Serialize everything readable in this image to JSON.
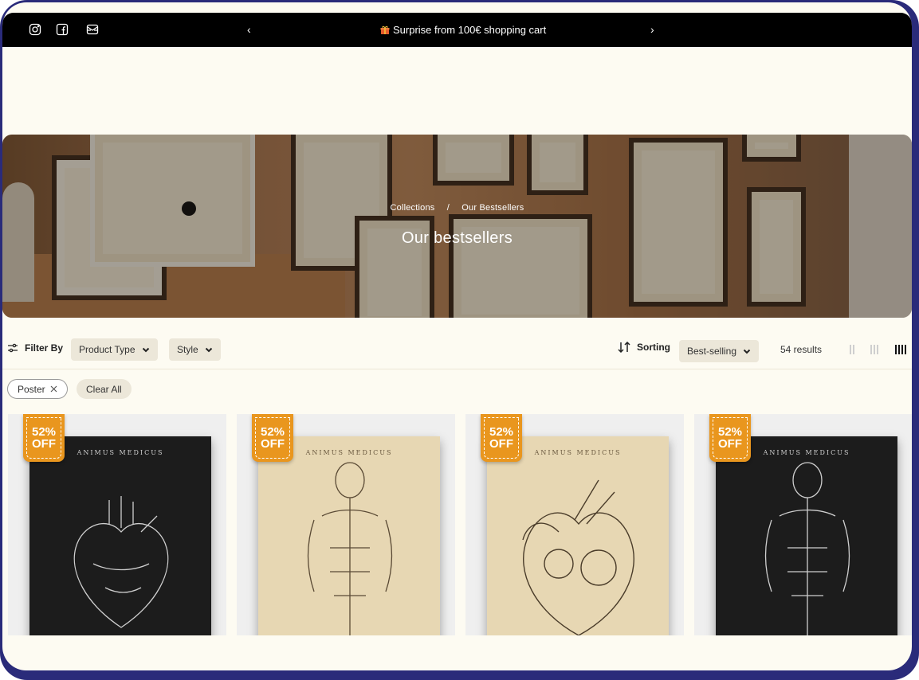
{
  "colors": {
    "frame": "#2a2b7a",
    "page_bg": "#fdfbf2",
    "announcement_bg": "#000000",
    "badge": "#e9961e",
    "pill_bg": "#ece7d9"
  },
  "announcement": {
    "social_icons": [
      "instagram-icon",
      "facebook-icon",
      "mail-icon"
    ],
    "prev_arrow": "‹",
    "next_arrow": "›",
    "message": "Surprise from 100€ shopping cart",
    "message_icon": "gift-icon"
  },
  "hero": {
    "breadcrumb": {
      "first": "Collections",
      "separator": "/",
      "current": "Our Bestsellers"
    },
    "title": "Our bestsellers"
  },
  "toolbar": {
    "filter_label": "Filter By",
    "filters": [
      {
        "label": "Product Type"
      },
      {
        "label": "Style"
      }
    ],
    "sorting_label": "Sorting",
    "sort_value": "Best-selling",
    "results": "54 results",
    "view_options": [
      "2-columns",
      "3-columns",
      "4-columns"
    ],
    "active_view": "4-columns"
  },
  "active_filters": {
    "chips": [
      {
        "label": "Poster",
        "remove_icon": "close-icon"
      }
    ],
    "clear_all": "Clear All"
  },
  "products": [
    {
      "badge_percent": "52%",
      "badge_text": "OFF",
      "poster_brand": "ANIMUS MEDICUS",
      "style": "dark",
      "subject": "heart"
    },
    {
      "badge_percent": "52%",
      "badge_text": "OFF",
      "poster_brand": "ANIMUS MEDICUS",
      "style": "light",
      "subject": "back muscles"
    },
    {
      "badge_percent": "52%",
      "badge_text": "OFF",
      "poster_brand": "ANIMUS MEDICUS",
      "style": "light",
      "subject": "heart section"
    },
    {
      "badge_percent": "52%",
      "badge_text": "OFF",
      "poster_brand": "ANIMUS MEDICUS",
      "style": "dark",
      "subject": "back muscles"
    }
  ]
}
